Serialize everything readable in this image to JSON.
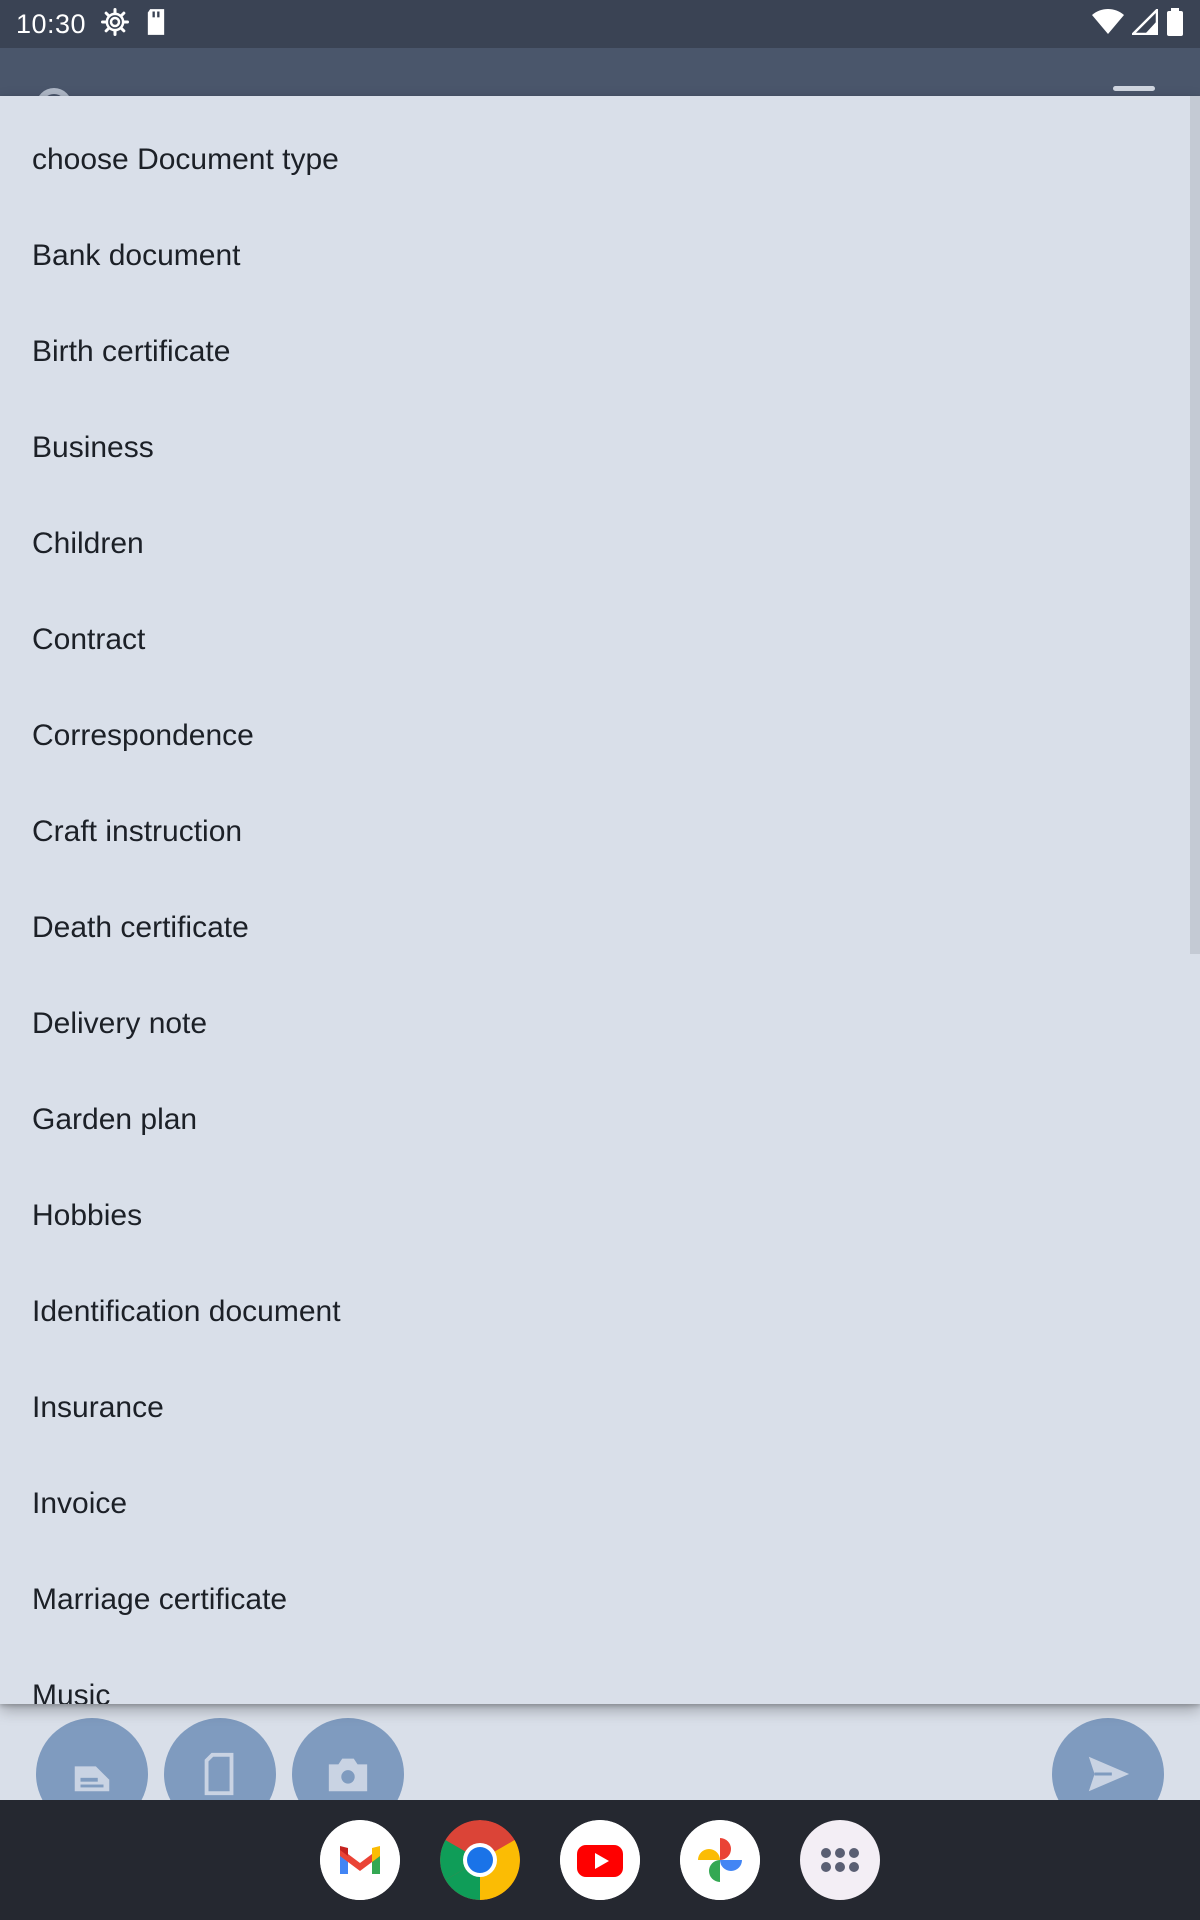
{
  "status_bar": {
    "time": "10:30",
    "icons": [
      "settings-gear-icon",
      "sd-card-icon",
      "wifi-icon",
      "signal-icon",
      "battery-icon"
    ]
  },
  "dropdown": {
    "label": "choose Document type",
    "options": [
      "choose Document type",
      "Bank document",
      "Birth certificate",
      "Business",
      "Children",
      "Contract",
      "Correspondence",
      "Craft instruction",
      "Death certificate",
      "Delivery note",
      "Garden plan",
      "Hobbies",
      "Identification document",
      "Insurance",
      "Invoice",
      "Marriage certificate",
      "Music"
    ]
  },
  "app_actions": [
    "scan-icon",
    "file-icon",
    "camera-icon",
    "send-icon"
  ],
  "dock": {
    "apps": [
      "gmail-icon",
      "chrome-icon",
      "youtube-icon",
      "photos-icon",
      "app-drawer-icon"
    ]
  },
  "colors": {
    "status_bar_bg": "#3a4354",
    "menu_bg": "#d9dfe9",
    "fab_bg": "#7f9bbf",
    "dock_bg": "#252830"
  }
}
